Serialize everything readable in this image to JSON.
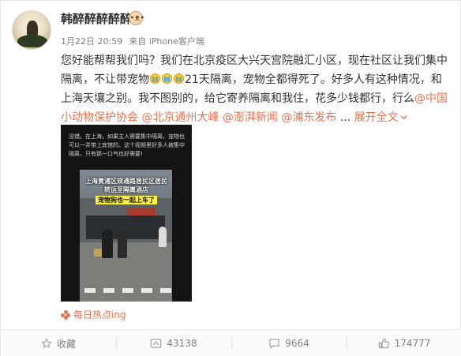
{
  "user": {
    "name": "韩醉醉醉醉醉",
    "badge_icon": "cat-face-icon"
  },
  "meta": {
    "date": "1月22日 20:59",
    "source_prefix": "来自",
    "source": "iPhone客户端"
  },
  "post": {
    "text_1": "您好能帮帮我们吗？我们在北京疫区大兴天宫院融汇小区，现在社区让我们集中隔离，不让带宠物",
    "text_2": "21天隔离，宠物全都得死了。好多人有这种情况，和上海天壤之别。我不图别的，给它寄养隔离和我住，花多少钱都行，行么",
    "mentions": [
      "@中国小动物保护协会",
      "@北京通州大峰",
      "@澎湃新闻",
      "@浦东发布"
    ],
    "ellipsis": "...",
    "expand_label": "展开全文",
    "expand_icon": "chevron-down-icon"
  },
  "media": {
    "caption": "没错。在上海，如果主人需要集中隔离，宠物也可以一并带上宾馆的。这个视频里好多人被集中隔离，只有那一口气也好需要!",
    "overlay_line1": "上海黄浦区规通路居民区居民",
    "overlay_line2": "转运至隔离酒店",
    "overlay_badge": "宠物狗也一起上车了"
  },
  "topic": {
    "label": "每日热点ing",
    "icon": "flower-icon"
  },
  "actions": {
    "favorite_label": "收藏",
    "share_count": "43138",
    "comment_count": "9664",
    "like_count": "174777"
  },
  "colors": {
    "accent": "#eb7350",
    "text": "#333333",
    "meta": "#808080"
  }
}
